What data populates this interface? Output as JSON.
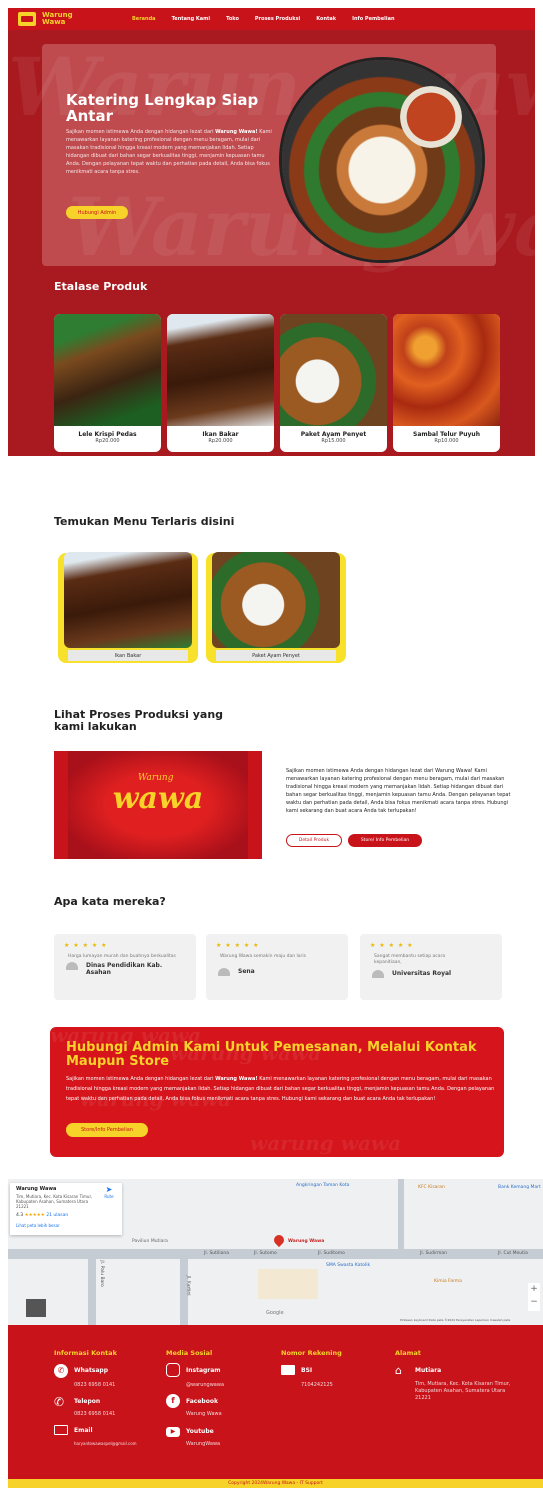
{
  "nav": {
    "brand": "Warung Wawa",
    "items": [
      "Beranda",
      "Tentang Kami",
      "Toko",
      "Proses Produksi",
      "Kontak",
      "Info Pembelian"
    ]
  },
  "hero": {
    "watermark": "Warung wawa",
    "title": "Katering Lengkap Siap Antar",
    "text_before": "Sajikan momen istimewa Anda dengan hidangan lezat dari ",
    "brand_bold": "Warung Wawa!",
    "text_after": " Kami menawarkan layanan katering profesional dengan menu beragam, mulai dari masakan tradisional hingga kreasi modern yang memanjakan lidah. Setiap hidangan dibuat dari bahan segar berkualitas tinggi, menjamin kepuasan tamu Anda. Dengan pelayanan tepat waktu dan perhatian pada detail, Anda bisa fokus menikmati acara tanpa stres.",
    "button": "Hubungi Admin"
  },
  "etalase": {
    "title": "Etalase Produk",
    "products": [
      {
        "name": "Lele Krispi Pedas",
        "price": "Rp20.000"
      },
      {
        "name": "Ikan Bakar",
        "price": "Rp20.000"
      },
      {
        "name": "Paket Ayam Penyet",
        "price": "Rp15.000"
      },
      {
        "name": "Sambal Telur Puyuh",
        "price": "Rp10.000"
      }
    ]
  },
  "best": {
    "title": "Temukan Menu Terlaris disini",
    "items": [
      "Ikan Bakar",
      "Paket Ayam Penyet"
    ]
  },
  "process": {
    "title": "Lihat Proses Produksi yang kami lakukan",
    "logo_small": "Warung",
    "logo_big": "wawa",
    "text": "Sajikan momen istimewa Anda dengan hidangan lezat dari Warung Wawa! Kami menawarkan layanan katering profesional dengan menu beragam, mulai dari masakan tradisional hingga kreasi modern yang memanjakan lidah. Setiap hidangan dibuat dari bahan segar berkualitas tinggi, menjamin kepuasan tamu Anda. Dengan pelayanan tepat waktu dan perhatian pada detail, Anda bisa fokus menikmati acara tanpa stres. Hubungi kami sekarang dan buat acara Anda tak terlupakan!",
    "btn_detail": "Detail Produk",
    "btn_store": "Store/ Info Pembelian"
  },
  "testimonials": {
    "title": "Apa kata mereka?",
    "stars": "★ ★ ★ ★ ★",
    "items": [
      {
        "text": "Harga lumayan murah dan buahnya berkualitas",
        "name": "Dinas Pendidikan Kab. Asahan"
      },
      {
        "text": "Warung Wawa semakin maju dan laris",
        "name": "Sena"
      },
      {
        "text": "Sangat membantu setiap acara kepanitiaan,",
        "name": "Universitas Royal"
      }
    ]
  },
  "cta": {
    "watermark": "warung wawa",
    "title": "Hubungi Admin Kami Untuk Pemesanan, Melalui Kontak Maupun Store",
    "text_before": "Sajikan momen istimewa Anda dengan hidangan lezat dari ",
    "brand_bold": "Warung Wawa!",
    "text_after": " Kami menawarkan layanan katering profesional dengan menu beragam, mulai dari masakan tradisional hingga kreasi modern yang memanjakan lidah. Setiap hidangan dibuat dari bahan segar berkualitas tinggi, menjamin kepuasan tamu Anda. Dengan pelayanan tepat waktu dan perhatian pada detail, Anda bisa fokus menikmati acara tanpa stres. Hubungi kami sekarang dan buat acara Anda tak terlupakan!",
    "button": "Store/Info Pembelian"
  },
  "map": {
    "place_name": "Warung Wawa",
    "address": "Tim, Mutiara, Kec. Kota Kisaran Timur, Kabupaten Asahan, Sumatera Utara 21221",
    "rating": "4.3",
    "stars": "★★★★★",
    "reviews": "21 ulasan",
    "larger_map": "Lihat peta lebih besar",
    "directions": "Rute",
    "pin_label": "Warung Wawa",
    "labels": [
      "Angkringan Taman Kota",
      "Paviliun Mutiara",
      "Jl. Palu Baro",
      "Jl. Sutiliana",
      "Jl. Sutomo",
      "Jl. Suditomo",
      "Jl. Sudirman",
      "Jl. Cut Meutia",
      "Jl. Kartini",
      "SMA Swasta Katolik",
      "KFC Kisaran",
      "Kimia Farma",
      "Bank Kemang Mart"
    ],
    "google": "Google",
    "attribution": "Pintasan keyboard   Data peta ©2024   Persyaratan   Laporkan masalah peta",
    "zoom_in": "+",
    "zoom_out": "−"
  },
  "footer": {
    "kontak": {
      "title": "Informasi Kontak",
      "whatsapp_label": "Whatsapp",
      "whatsapp": "0823 6958 0141",
      "telepon_label": "Telepon",
      "telepon": "0823 6958 0141",
      "email_label": "Email",
      "email": "haryantowawaspel@gmail.com"
    },
    "media": {
      "title": "Media Sosial",
      "instagram_label": "Instagram",
      "instagram": "@warungwawa",
      "facebook_label": "Facebook",
      "facebook": "Warung Wawa",
      "youtube_label": "Youtube",
      "youtube": "WarungWawa"
    },
    "rekening": {
      "title": "Nomor Rekening",
      "bank_label": "BSI",
      "bank": "7104242125"
    },
    "alamat": {
      "title": "Alamat",
      "area": "Mutiara",
      "address": "Tim, Mutiara, Kec. Kota Kisaran Timur, Kabupaten Asahan, Sumatera Utara 21221"
    },
    "copyright": "Copyright 2024Warung Wawa - IT Support"
  },
  "colors": {
    "primary": "#c8131b",
    "accent": "#f7d229"
  }
}
